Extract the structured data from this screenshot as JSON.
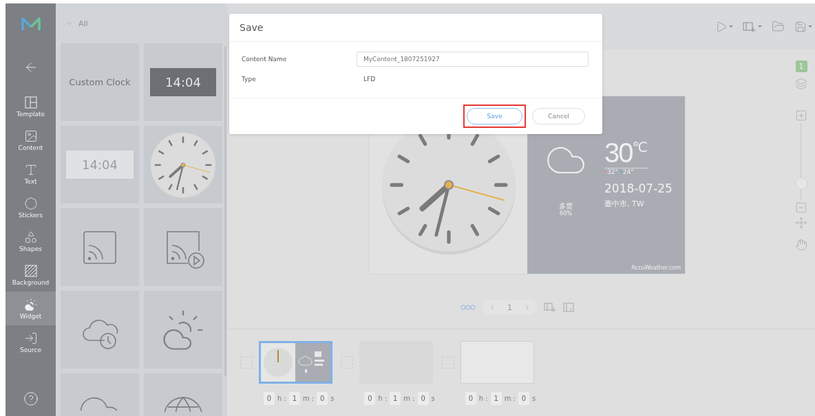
{
  "sidebar": {
    "items": [
      {
        "label": "Template",
        "selected": false
      },
      {
        "label": "Content",
        "selected": false
      },
      {
        "label": "Text",
        "selected": false
      },
      {
        "label": "Stickers",
        "selected": false
      },
      {
        "label": "Shapes",
        "selected": false
      },
      {
        "label": "Background",
        "selected": false
      },
      {
        "label": "Widget",
        "selected": true
      },
      {
        "label": "Source",
        "selected": false
      }
    ]
  },
  "panel": {
    "filter": "All",
    "tiles": [
      {
        "kind": "label",
        "text": "Custom Clock"
      },
      {
        "kind": "digital-dark",
        "text": "14:04"
      },
      {
        "kind": "digital-light",
        "text": "14:04"
      },
      {
        "kind": "analog"
      },
      {
        "kind": "feed"
      },
      {
        "kind": "feed-play"
      },
      {
        "kind": "cloud-clock"
      },
      {
        "kind": "sun-cloud"
      },
      {
        "kind": "cloud"
      },
      {
        "kind": "globe"
      }
    ]
  },
  "stage": {
    "layer_badge": "1",
    "zoom": {
      "level": 0.16
    },
    "weather": {
      "temperature": "30",
      "unit": "℃",
      "high": "32°",
      "low": "24°",
      "condition": "多雲",
      "humidity": "60%",
      "date": "2018-07-25",
      "location": "臺中市, TW",
      "credit": "AccuWeather.com"
    },
    "pager": {
      "page": "1"
    }
  },
  "slides": [
    {
      "kind": "widget",
      "selected": true,
      "checked": false,
      "duration": [
        {
          "value": "0",
          "unit": "h :"
        },
        {
          "value": "1",
          "unit": "m :"
        },
        {
          "value": "0",
          "unit": "s"
        }
      ]
    },
    {
      "kind": "blank-gray",
      "selected": false,
      "checked": false,
      "duration": [
        {
          "value": "0",
          "unit": "h :"
        },
        {
          "value": "1",
          "unit": "m :"
        },
        {
          "value": "0",
          "unit": "s"
        }
      ]
    },
    {
      "kind": "blank-white",
      "selected": false,
      "checked": false,
      "duration": [
        {
          "value": "0",
          "unit": "h :"
        },
        {
          "value": "1",
          "unit": "m :"
        },
        {
          "value": "0",
          "unit": "s"
        }
      ]
    }
  ],
  "dialog": {
    "title": "Save",
    "fields": [
      {
        "kind": "input",
        "label": "Content Name",
        "value": "MyContent_1807251927"
      },
      {
        "kind": "text",
        "label": "Type",
        "value": "LFD"
      }
    ],
    "buttons": [
      {
        "label": "Save",
        "primary": true,
        "highlighted": true
      },
      {
        "label": "Cancel",
        "primary": false,
        "highlighted": false
      }
    ]
  }
}
